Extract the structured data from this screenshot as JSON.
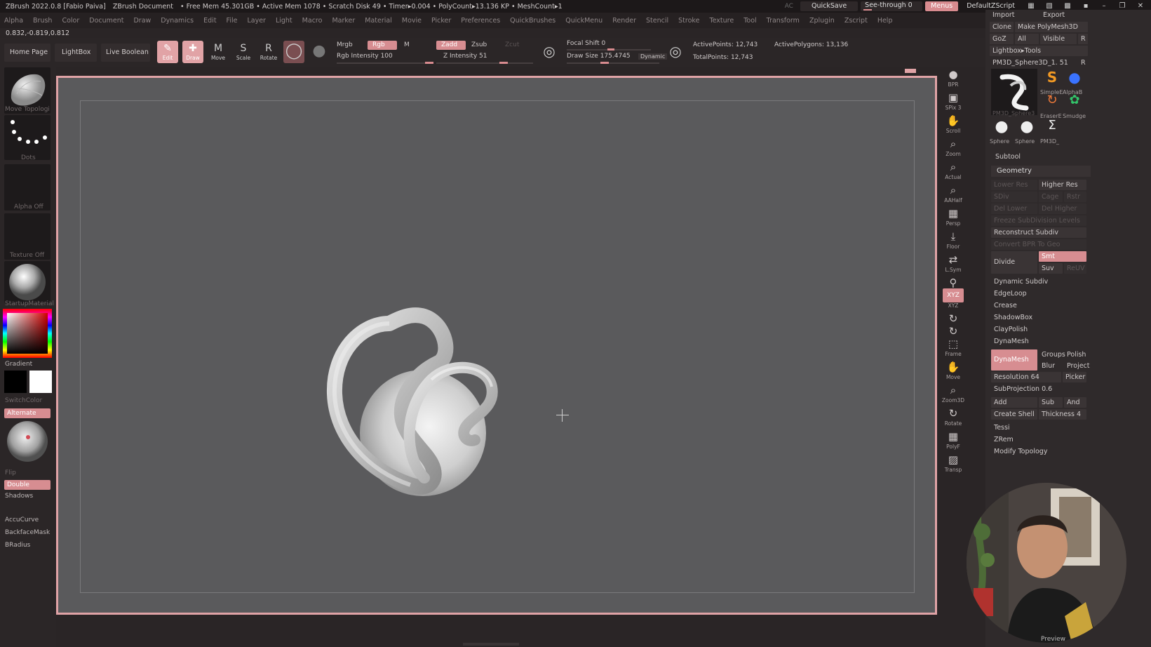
{
  "titlebar": {
    "app_title": "ZBrush 2022.0.8 [Fabio Paiva]",
    "document": "ZBrush Document",
    "stats": "• Free Mem 45.301GB • Active Mem 1078 • Scratch Disk 49 • Timer▸0.004 • PolyCount▸13.136 KP • MeshCount▸1",
    "ac_label": "AC",
    "quicksave": "QuickSave",
    "seethrough": "See-through  0",
    "menus": "Menus",
    "script": "DefaultZScript"
  },
  "menubar": [
    "Alpha",
    "Brush",
    "Color",
    "Document",
    "Draw",
    "Dynamics",
    "Edit",
    "File",
    "Layer",
    "Light",
    "Macro",
    "Marker",
    "Material",
    "Movie",
    "Picker",
    "Preferences",
    "QuickBrushes",
    "QuickMenu",
    "Render",
    "Stencil",
    "Stroke",
    "Texture",
    "Tool",
    "Transform",
    "Zplugin",
    "Zscript",
    "Help"
  ],
  "coords": "0.832,-0.819,0.812",
  "shelf": {
    "home": "Home Page",
    "lightbox": "LightBox",
    "live_boolean": "Live Boolean",
    "edit": "Edit",
    "draw": "Draw",
    "move": "Move",
    "scale": "Scale",
    "rotate": "Rotate",
    "mrgb": "Mrgb",
    "rgb": "Rgb",
    "m": "M",
    "rgb_intensity": "Rgb Intensity 100",
    "zadd": "Zadd",
    "zsub": "Zsub",
    "zcut": "Zcut",
    "z_intensity": "Z Intensity 51",
    "focal_shift": "Focal Shift 0",
    "draw_size": "Draw Size 175.4745",
    "dynamic": "Dynamic",
    "active_points": "ActivePoints: 12,743",
    "total_points": "TotalPoints: 12,743",
    "active_polygons": "ActivePolygons: 13,136"
  },
  "left_palette": {
    "brush": "Move Topologi",
    "stroke": "Dots",
    "alpha": "Alpha Off",
    "texture": "Texture Off",
    "material": "StartupMaterial",
    "gradient": "Gradient",
    "switch_color": "SwitchColor",
    "alternate": "Alternate",
    "flip": "Flip",
    "double": "Double",
    "shadows": "Shadows",
    "accucurve": "AccuCurve",
    "backfacemask": "BackfaceMask",
    "bradius": "BRadius"
  },
  "nav": [
    "BPR",
    "SPix 3",
    "Scroll",
    "Zoom",
    "Actual",
    "AAHalf",
    "Persp",
    "Floor",
    "L.Sym",
    "",
    "XYZ",
    "",
    "",
    "Frame",
    "Move",
    "Zoom3D",
    "Rotate",
    "PolyF",
    "Transp"
  ],
  "right_panel": {
    "import": "Import",
    "export": "Export",
    "clone": "Clone",
    "make_polymesh": "Make PolyMesh3D",
    "goz": "GoZ",
    "all": "All",
    "visible": "Visible",
    "r": "R",
    "lightbox_tools": "Lightbox▸Tools",
    "current_tool": "PM3D_Sphere3D_1. 51",
    "tool_r": "R",
    "tools": [
      "SimpleE",
      "AlphaB",
      "EraserE",
      "Smudge",
      "Sphere",
      "Sphere",
      "PM3D_"
    ],
    "big_tool_label": "PM3D_Sphere3",
    "subtool": "Subtool",
    "geometry": "Geometry",
    "lower_res": "Lower Res",
    "higher_res": "Higher Res",
    "sdiv": "SDiv",
    "cage": "Cage",
    "rstr": "Rstr",
    "del_lower": "Del Lower",
    "del_higher": "Del Higher",
    "freeze_subdiv": "Freeze SubDivision Levels",
    "reconstruct_subdiv": "Reconstruct Subdiv",
    "convert_bpr": "Convert BPR To Geo",
    "divide": "Divide",
    "smt": "Smt",
    "suv": "Suv",
    "reuv": "ReUV",
    "dynamic_subdiv": "Dynamic Subdiv",
    "edgeloop": "EdgeLoop",
    "crease": "Crease",
    "shadowbox": "ShadowBox",
    "claypolish": "ClayPolish",
    "dynamesh_section": "DynaMesh",
    "dynamesh_btn": "DynaMesh",
    "groups": "Groups",
    "polish": "Polish",
    "blur": "Blur",
    "project": "Project",
    "resolution": "Resolution 64",
    "picker": "Picker",
    "subprojection": "SubProjection 0.6",
    "add": "Add",
    "sub": "Sub",
    "and": "And",
    "create_shell": "Create Shell",
    "thickness": "Thickness 4",
    "tessimate": "Tessi",
    "zremesher": "ZRem",
    "modify_topology": "Modify Topology"
  },
  "webcam_label": "Preview",
  "colors": {
    "accent": "#d78d91",
    "canvas": "#5a5a5c",
    "frame": "#e0a3a6",
    "panel": "#2f2a2b"
  }
}
